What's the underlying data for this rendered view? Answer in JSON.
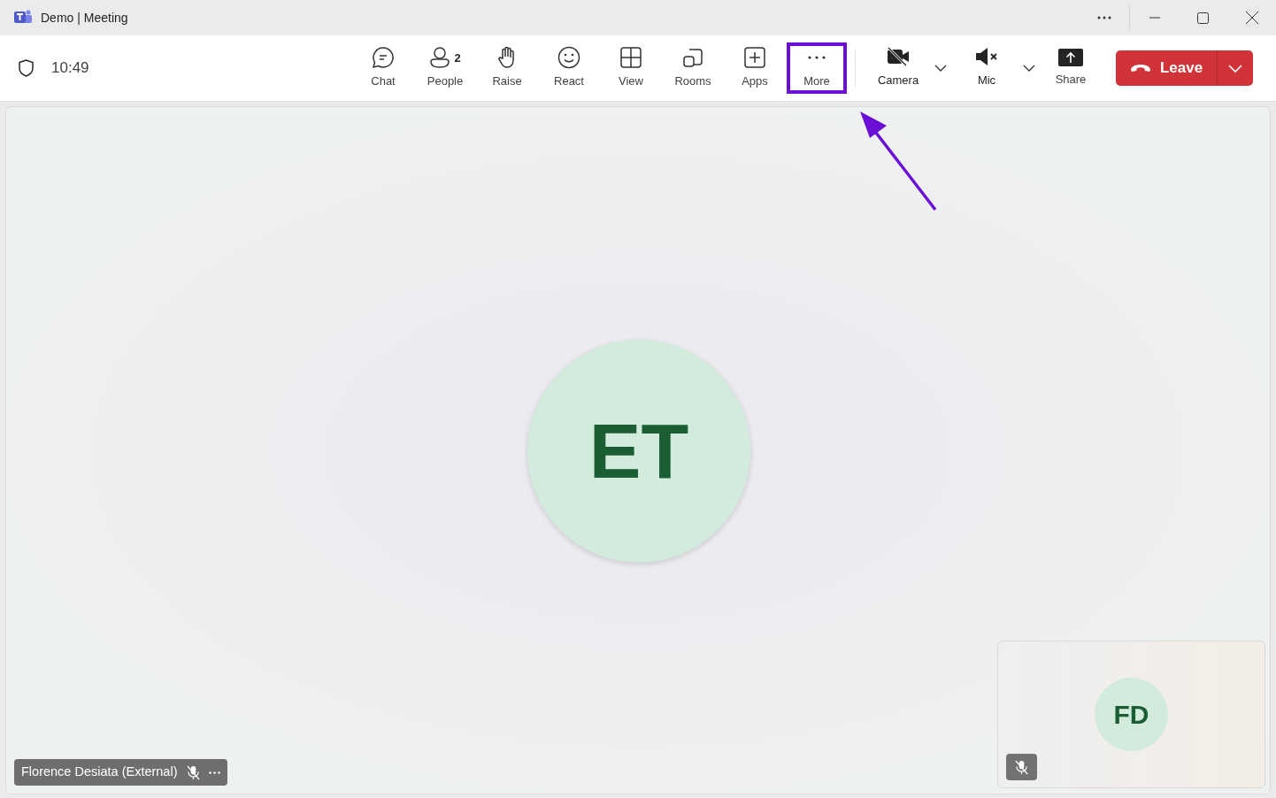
{
  "window": {
    "title": "Demo | Meeting"
  },
  "meeting_bar": {
    "time": "10:49",
    "buttons": [
      {
        "kind": "chat",
        "label": "Chat",
        "highlighted": false
      },
      {
        "kind": "people",
        "label": "People",
        "badge": "2",
        "highlighted": false
      },
      {
        "kind": "raise",
        "label": "Raise",
        "highlighted": false
      },
      {
        "kind": "react",
        "label": "React",
        "highlighted": false
      },
      {
        "kind": "view",
        "label": "View",
        "highlighted": false
      },
      {
        "kind": "rooms",
        "label": "Rooms",
        "highlighted": false
      },
      {
        "kind": "apps",
        "label": "Apps",
        "highlighted": false
      },
      {
        "kind": "more",
        "label": "More",
        "highlighted": true
      }
    ],
    "devices": [
      {
        "kind": "camera",
        "label": "Camera",
        "off": true
      },
      {
        "kind": "mic",
        "label": "Mic",
        "off": true
      }
    ],
    "share": {
      "label": "Share"
    },
    "leave": {
      "label": "Leave"
    }
  },
  "stage": {
    "main_participant": {
      "initials": "ET"
    },
    "name_tag": {
      "name": "Florence Desiata (External)",
      "muted": true
    },
    "self_view": {
      "initials": "FD",
      "muted": true
    }
  }
}
